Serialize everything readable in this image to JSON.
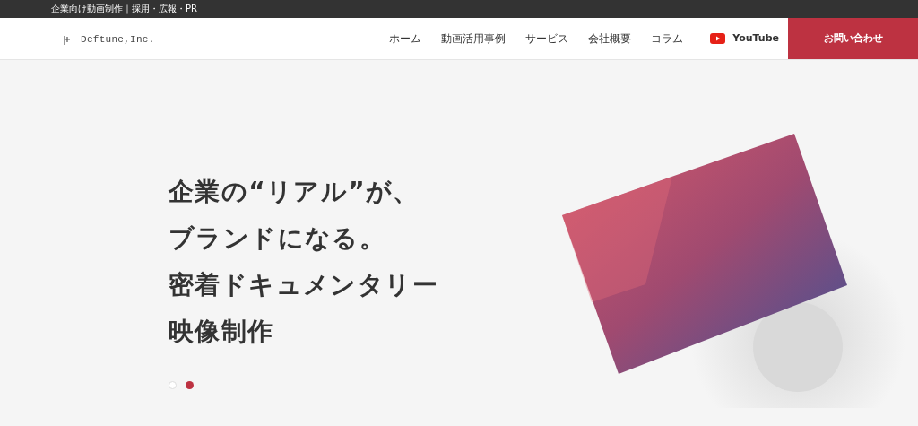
{
  "top_bar": {
    "text": "企業向け動画制作｜採用・広報・PR"
  },
  "header": {
    "logo_text": "Deftune,Inc.",
    "nav": [
      {
        "label": "ホーム"
      },
      {
        "label": "動画活用事例"
      },
      {
        "label": "サービス"
      },
      {
        "label": "会社概要"
      },
      {
        "label": "コラム"
      }
    ],
    "youtube": "YouTube",
    "contact": "お問い合わせ"
  },
  "hero": {
    "lines": [
      "企業の“リアル”が、",
      "ブランドになる。",
      "密着ドキュメンタリー",
      "映像制作"
    ],
    "dots": [
      {
        "selected": false
      },
      {
        "selected": true
      }
    ]
  }
}
